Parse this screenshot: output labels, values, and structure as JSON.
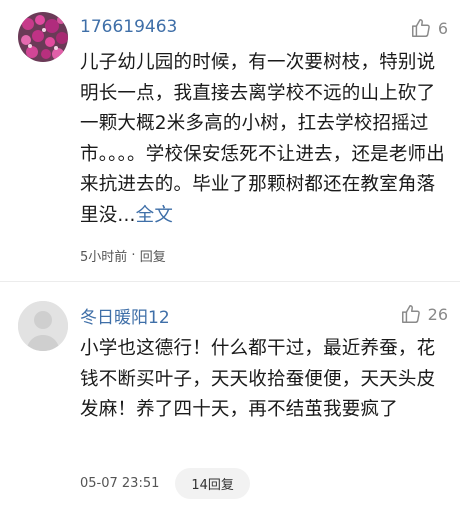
{
  "comments": [
    {
      "username": "176619463",
      "likes": "6",
      "avatar": "pink-flower-photo",
      "text": "儿子幼儿园的时候，有一次要树枝，特别说明长一点，我直接去离学校不远的山上砍了一颗大概2米多高的小树，扛去学校招摇过市。。。。学校保安恁死不让进去，还是老师出来抗进去的。毕业了那颗树都还在教室角落里没...",
      "full_text_link": "全文",
      "time": "5小时前",
      "reply_label": "回复"
    },
    {
      "username": "冬日暖阳12",
      "likes": "26",
      "avatar": "default-user-avatar",
      "text": "小学也这德行！什么都干过，最近养蚕，花钱不断买叶子，天天收拾蚕便便，天天头皮发麻！养了四十天，再不结茧我要疯了",
      "time": "05-07 23:51",
      "reply_label": "14回复"
    }
  ],
  "colors": {
    "username": "#3f6fa8",
    "like": "#8a8a8a",
    "text": "#1a1a1a",
    "meta": "#555555"
  }
}
